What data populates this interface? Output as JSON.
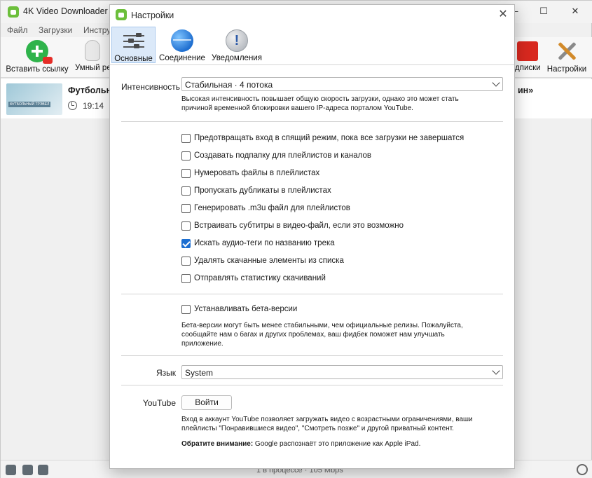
{
  "main_window": {
    "title": "4K Video Downloader –",
    "win_controls": [
      "—",
      "☐",
      "✕"
    ],
    "menu": [
      "Файл",
      "Загрузки",
      "Инстру"
    ],
    "toolbar": {
      "paste_label": "Вставить ссылку",
      "smart_label": "Умный реж",
      "subs_label": "дписки",
      "settings_label": "Настройки"
    },
    "download_item": {
      "title_start": "Футбольн",
      "title_end": "ин»",
      "time": "19:14",
      "thumb_caption": "ФУТБОЛЬНЫЙ ТРЭВЕЛ"
    },
    "status_text": "1 в процессе · 105 Mbps"
  },
  "dialog": {
    "title": "Настройки",
    "close": "✕",
    "tabs": [
      {
        "label": "Основные",
        "icon": "sliders-icon",
        "active": true
      },
      {
        "label": "Соединение",
        "icon": "globe-icon",
        "active": false
      },
      {
        "label": "Уведомления",
        "icon": "exclamation-icon",
        "active": false
      }
    ],
    "intensity": {
      "label": "Интенсивность",
      "value": "Стабильная · 4 потока",
      "hint_line1": "Высокая интенсивность повышает общую скорость загрузки, однако это может стать",
      "hint_line2": "причиной временной блокировки вашего IP-адреса порталом YouTube."
    },
    "options": [
      {
        "label": "Предотвращать вход в спящий режим, пока все загрузки не завершатся",
        "checked": false
      },
      {
        "label": "Создавать подпапку для плейлистов и каналов",
        "checked": false
      },
      {
        "label": "Нумеровать файлы в плейлистах",
        "checked": false
      },
      {
        "label": "Пропускать дубликаты в плейлистах",
        "checked": false
      },
      {
        "label": "Генерировать .m3u файл для плейлистов",
        "checked": false
      },
      {
        "label": "Встраивать субтитры в видео-файл, если это возможно",
        "checked": false
      },
      {
        "label": "Искать аудио-теги по названию трека",
        "checked": true
      },
      {
        "label": "Удалять скачанные элементы из списка",
        "checked": false
      },
      {
        "label": "Отправлять статистику скачиваний",
        "checked": false
      }
    ],
    "beta": {
      "label": "Устанавливать бета-версии",
      "checked": false,
      "hint_line1": "Бета-версии могут быть менее стабильными, чем официальные релизы.  Пожалуйста,",
      "hint_line2": "сообщайте нам о багах и других проблемах, ваш фидбек поможет нам улучшать",
      "hint_line3": "приложение."
    },
    "language": {
      "label": "Язык",
      "value": "System"
    },
    "youtube": {
      "label": "YouTube",
      "button": "Войти",
      "hint_line1": "Вход в аккаунт YouTube позволяет загружать видео с возрастными ограничениями, ваши",
      "hint_line2": "плейлисты \"Понравившиеся видео\", \"Смотреть позже\" и другой приватный контент.",
      "note_bold": "Обратите внимание:",
      "note_rest": " Google распознаёт это приложение как Apple iPad."
    }
  }
}
